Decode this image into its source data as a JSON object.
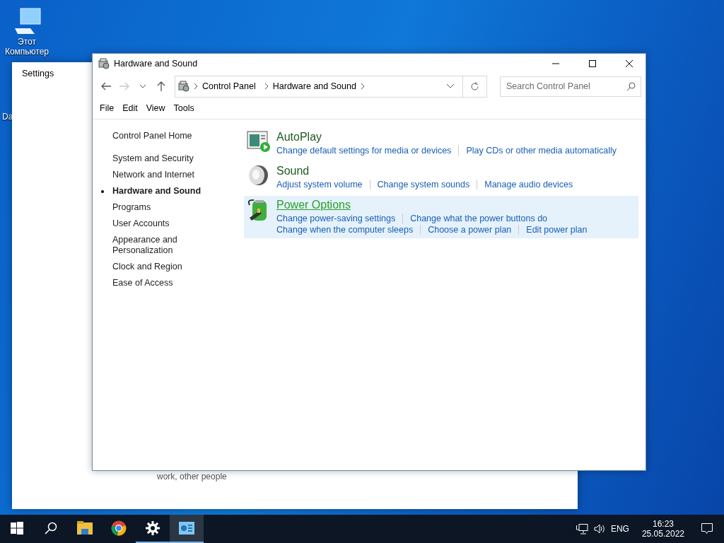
{
  "desktop_icons": [
    {
      "label": "Этот Компьютер",
      "kind": "computer"
    },
    {
      "label": "Da",
      "kind": "partial"
    }
  ],
  "settings_window": {
    "title": "Settings",
    "text": "work, other people"
  },
  "window": {
    "title": "Hardware and Sound",
    "address": {
      "crumbs": [
        "Control Panel",
        "Hardware and Sound"
      ]
    },
    "search": {
      "placeholder": "Search Control Panel"
    },
    "menu": [
      "File",
      "Edit",
      "View",
      "Tools"
    ],
    "sidebar": {
      "home": "Control Panel Home",
      "items": [
        {
          "label": "System and Security",
          "selected": false
        },
        {
          "label": "Network and Internet",
          "selected": false
        },
        {
          "label": "Hardware and Sound",
          "selected": true
        },
        {
          "label": "Programs",
          "selected": false
        },
        {
          "label": "User Accounts",
          "selected": false
        },
        {
          "label": "Appearance and Personalization",
          "selected": false
        },
        {
          "label": "Clock and Region",
          "selected": false
        },
        {
          "label": "Ease of Access",
          "selected": false
        }
      ]
    },
    "categories": [
      {
        "kind": "autoplay",
        "title": "AutoPlay",
        "highlighted": false,
        "lines": [
          [
            "Change default settings for media or devices",
            "Play CDs or other media automatically"
          ]
        ]
      },
      {
        "kind": "sound",
        "title": "Sound",
        "highlighted": false,
        "lines": [
          [
            "Adjust system volume",
            "Change system sounds",
            "Manage audio devices"
          ]
        ]
      },
      {
        "kind": "power",
        "title": "Power Options",
        "highlighted": true,
        "lines": [
          [
            "Change power-saving settings",
            "Change what the power buttons do"
          ],
          [
            "Change when the computer sleeps",
            "Choose a power plan",
            "Edit power plan"
          ]
        ]
      }
    ]
  },
  "taskbar": {
    "apps": [
      {
        "kind": "start",
        "running": false,
        "selected": false
      },
      {
        "kind": "search",
        "running": false,
        "selected": false
      },
      {
        "kind": "explorer",
        "running": false,
        "selected": false
      },
      {
        "kind": "browser",
        "running": false,
        "selected": false
      },
      {
        "kind": "settings",
        "running": true,
        "selected": false
      },
      {
        "kind": "controlpanel",
        "running": true,
        "selected": true
      }
    ],
    "language": "ENG",
    "time": "16:23",
    "date": "25.05.2022"
  }
}
